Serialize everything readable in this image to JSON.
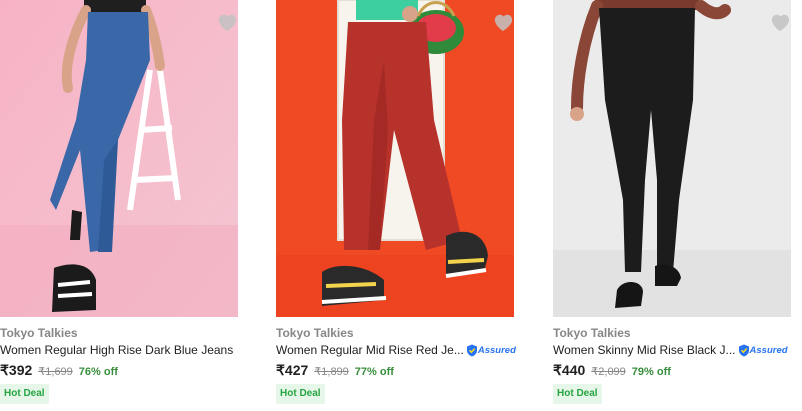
{
  "products": [
    {
      "brand": "Tokyo Talkies",
      "title": "Women Regular High Rise Dark Blue Jeans",
      "assured": false,
      "price": "₹392",
      "mrp": "₹1,699",
      "discount": "76% off",
      "deal": "Hot Deal",
      "wishlist_icon": "heart-icon"
    },
    {
      "brand": "Tokyo Talkies",
      "title": "Women Regular Mid Rise Red Je...",
      "assured": true,
      "assured_label": "Assured",
      "price": "₹427",
      "mrp": "₹1,899",
      "discount": "77% off",
      "deal": "Hot Deal",
      "wishlist_icon": "heart-icon"
    },
    {
      "brand": "Tokyo Talkies",
      "title": "Women Skinny Mid Rise Black J...",
      "assured": true,
      "assured_label": "Assured",
      "price": "₹440",
      "mrp": "₹2,099",
      "discount": "79% off",
      "deal": "Hot Deal",
      "wishlist_icon": "heart-icon"
    }
  ],
  "colors": {
    "discount_green": "#388e3c",
    "deal_green": "#26a541",
    "deal_bg": "#e6f6e9",
    "assured_blue": "#2874f0",
    "heart_grey": "#c2c2c2"
  }
}
